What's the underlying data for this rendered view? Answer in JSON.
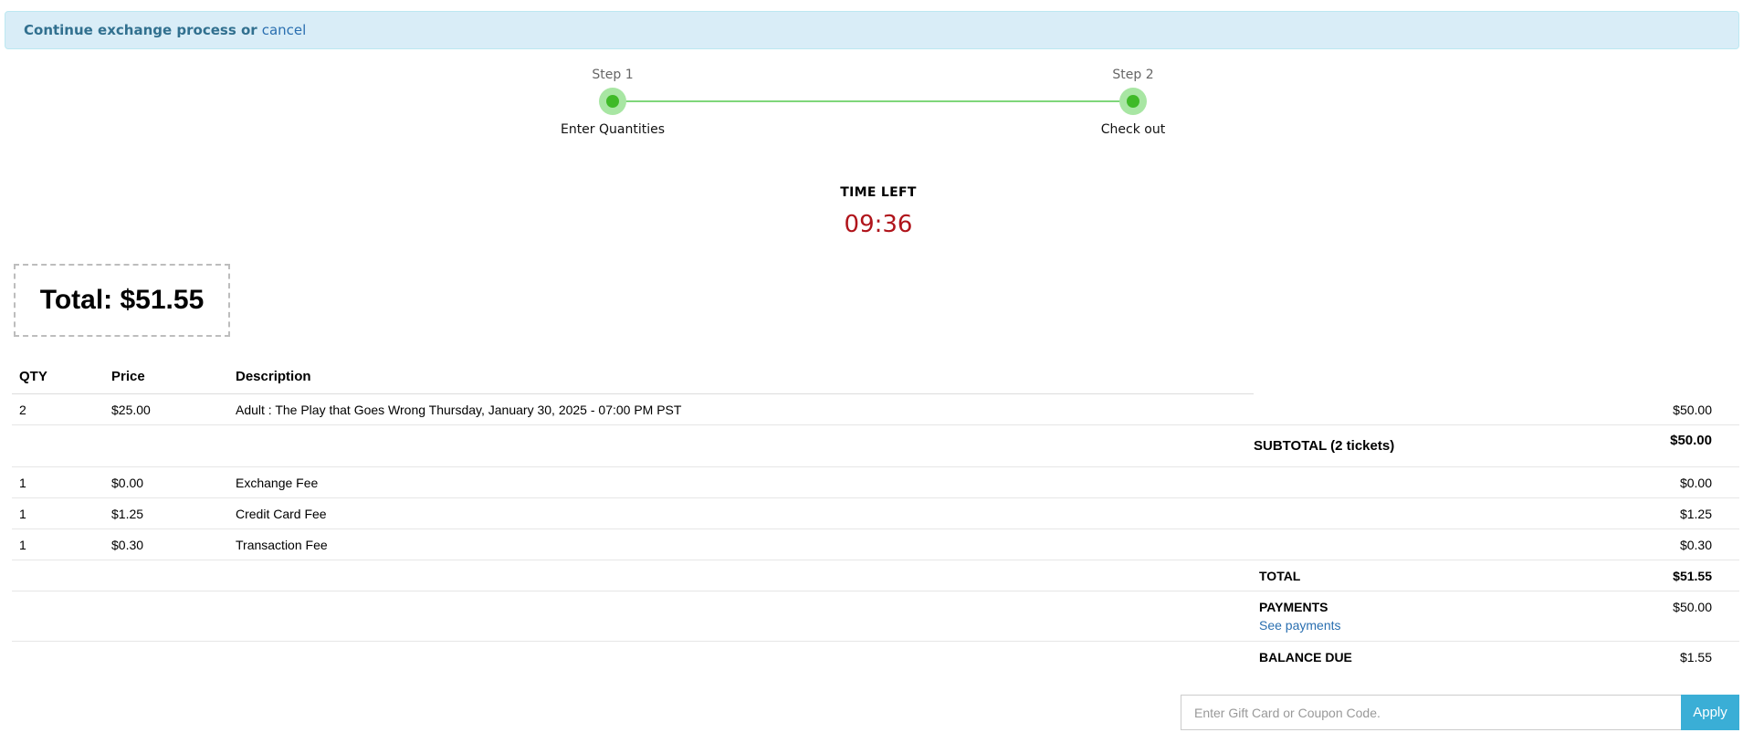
{
  "alert": {
    "text": "Continue exchange process or",
    "cancel_label": "cancel"
  },
  "steps": [
    {
      "number": "Step 1",
      "label": "Enter Quantities"
    },
    {
      "number": "Step 2",
      "label": "Check out"
    }
  ],
  "timer": {
    "label": "TIME LEFT",
    "value": "09:36"
  },
  "total_box": "Total: $51.55",
  "table": {
    "headers": {
      "qty": "QTY",
      "price": "Price",
      "description": "Description"
    },
    "line_items": [
      {
        "qty": "2",
        "price": "$25.00",
        "description": "Adult : The Play that Goes Wrong Thursday, January 30, 2025 - 07:00 PM PST",
        "amount": "$50.00"
      }
    ],
    "subtotal": {
      "label": "SUBTOTAL (2 tickets)",
      "amount": "$50.00"
    },
    "fees": [
      {
        "qty": "1",
        "price": "$0.00",
        "description": "Exchange Fee",
        "amount": "$0.00"
      },
      {
        "qty": "1",
        "price": "$1.25",
        "description": "Credit Card Fee",
        "amount": "$1.25"
      },
      {
        "qty": "1",
        "price": "$0.30",
        "description": "Transaction Fee",
        "amount": "$0.30"
      }
    ],
    "total": {
      "label": "TOTAL",
      "amount": "$51.55"
    },
    "payments": {
      "label": "PAYMENTS",
      "amount": "$50.00",
      "link": "See payments"
    },
    "balance_due": {
      "label": "BALANCE DUE",
      "amount": "$1.55"
    }
  },
  "coupon": {
    "placeholder": "Enter Gift Card or Coupon Code.",
    "apply_label": "Apply"
  },
  "colors": {
    "alert_bg": "#d9edf7",
    "step_dot": "#3fba28",
    "timer": "#b0141b",
    "link": "#2a6fb0",
    "apply_button": "#3aaed6"
  }
}
